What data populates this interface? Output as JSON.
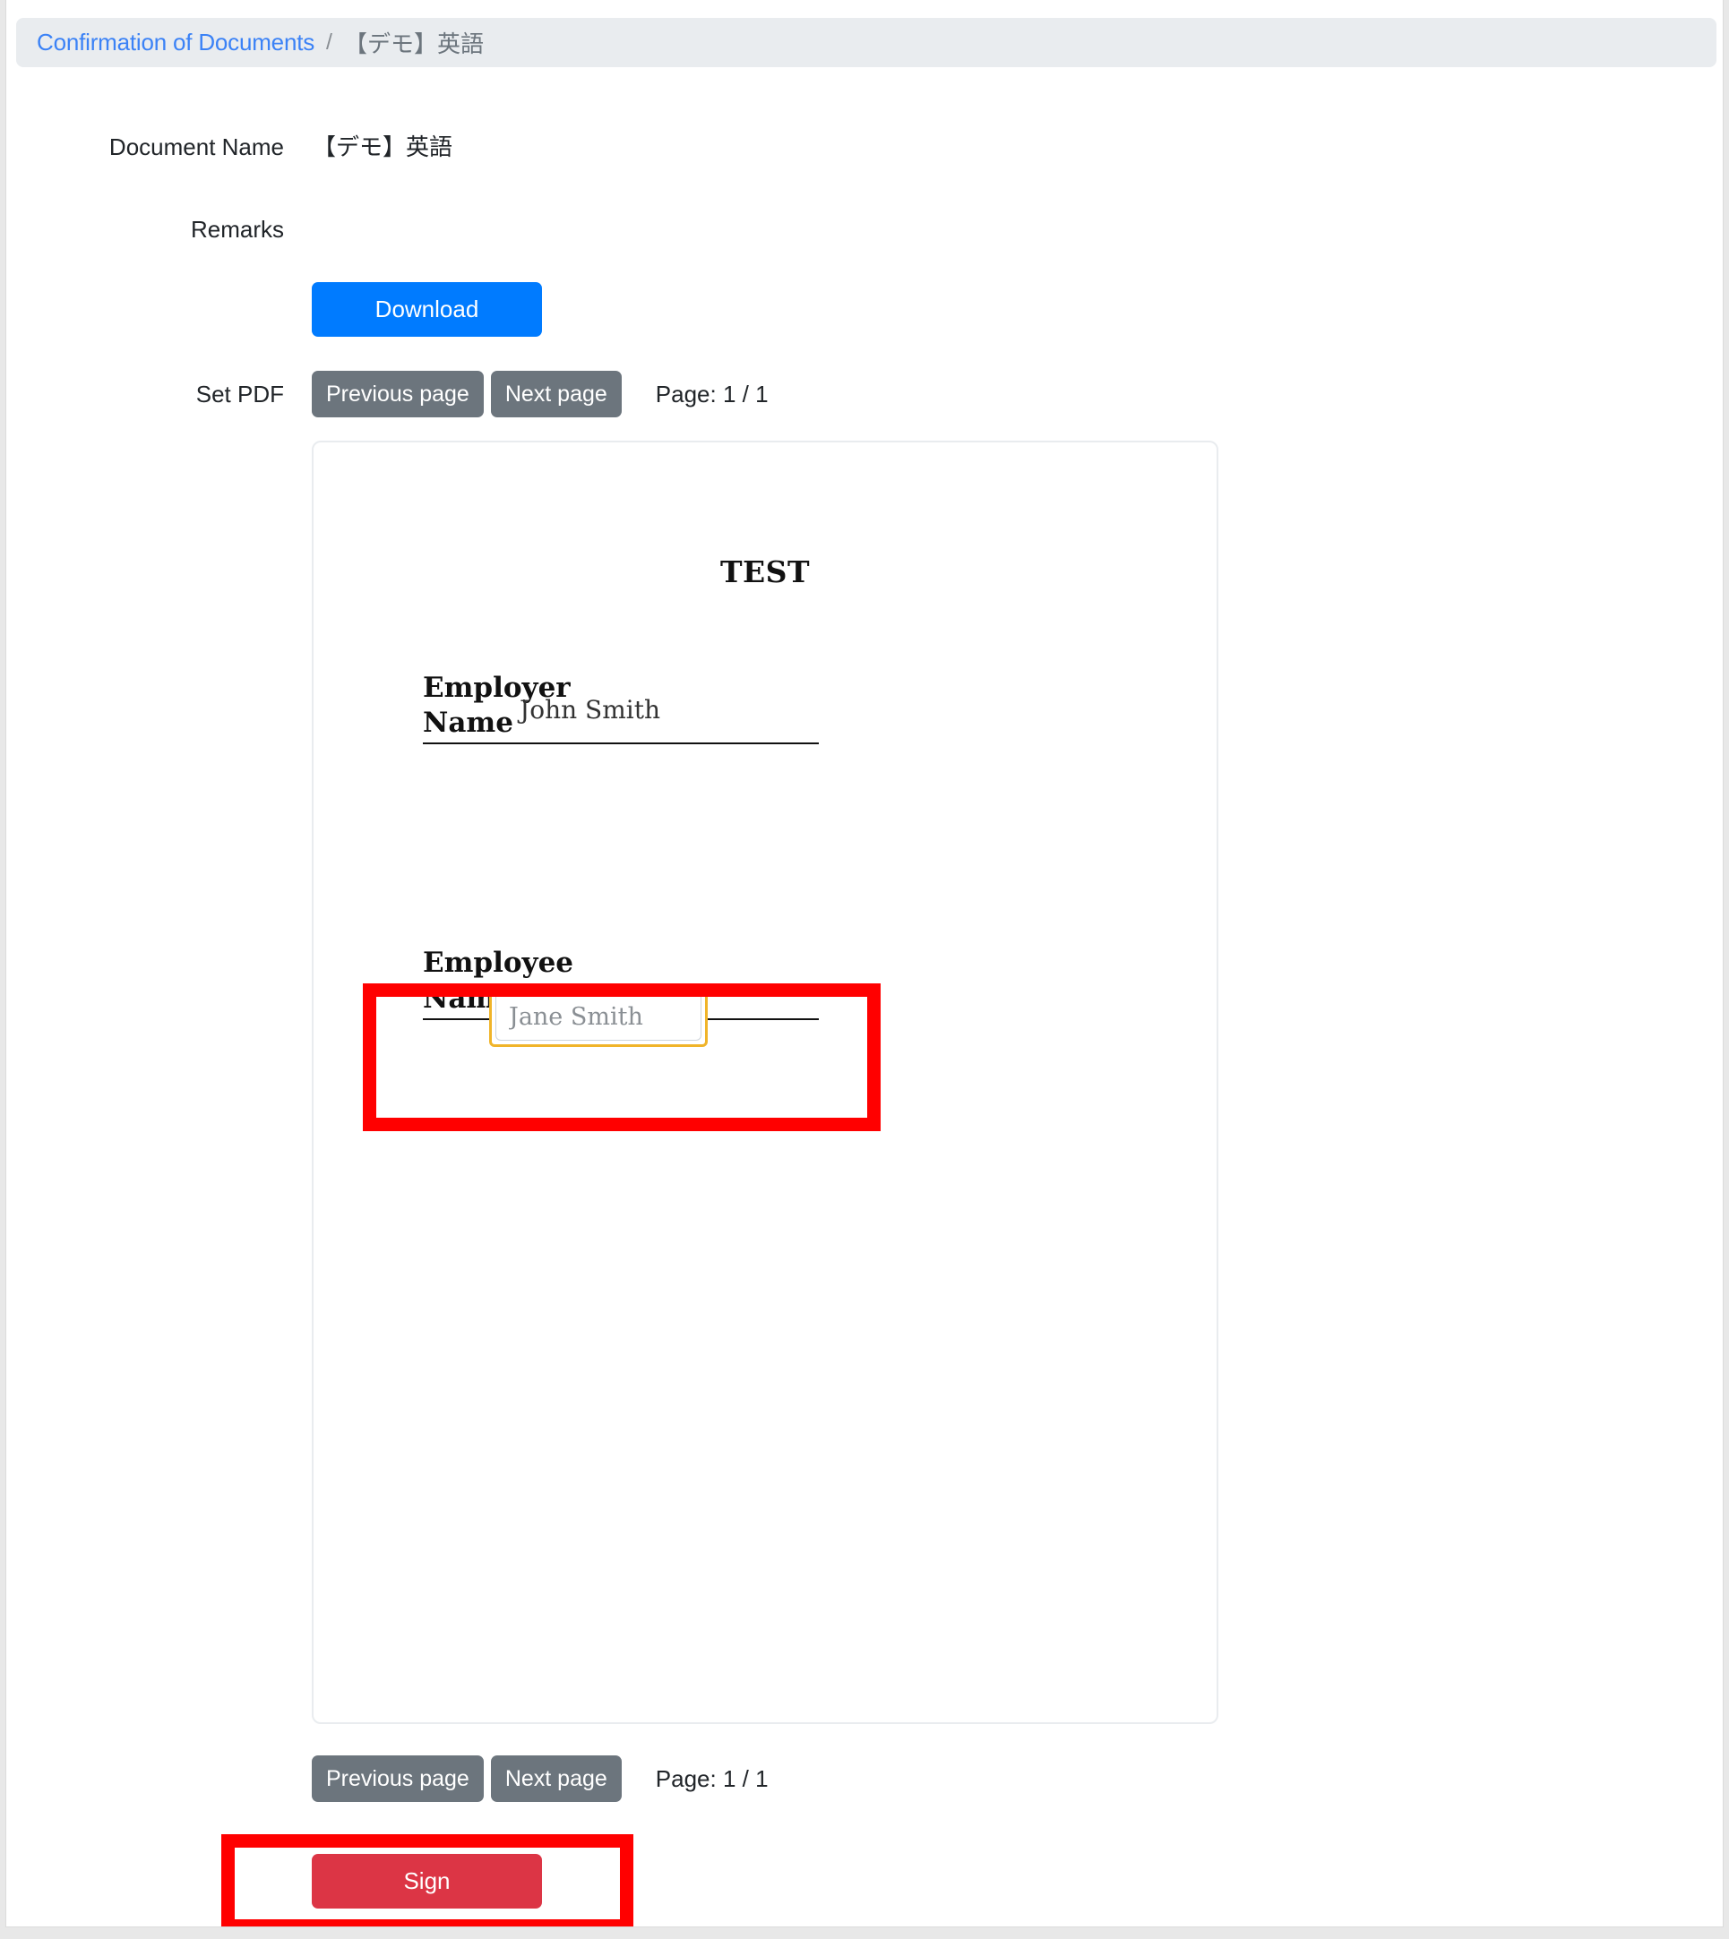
{
  "breadcrumb": {
    "link": "Confirmation of Documents",
    "separator": "/",
    "current": "【デモ】英語"
  },
  "form": {
    "document_name_label": "Document Name",
    "document_name_value": "【デモ】英語",
    "remarks_label": "Remarks",
    "remarks_value": "",
    "set_pdf_label": "Set PDF"
  },
  "buttons": {
    "download": "Download",
    "previous_page": "Previous page",
    "next_page": "Next page",
    "sign": "Sign"
  },
  "pager": {
    "top_indicator": "Page: 1 / 1",
    "bottom_indicator": "Page: 1 / 1"
  },
  "pdf": {
    "title": "TEST",
    "employer_heading": "Employer",
    "employer_name_label": "Name",
    "employer_name_value": "John Smith",
    "employee_heading": "Employee",
    "employee_name_label": "Name",
    "employee_name_placeholder": "Jane Smith",
    "employee_name_value": ""
  },
  "colors": {
    "breadcrumb_link": "#3b82f6",
    "breadcrumb_bg": "#e9ecef",
    "download_button": "#007bff",
    "page_button": "#6c757d",
    "sign_button": "#dc3545",
    "annotation_highlight": "#ff0000",
    "input_focus_ring": "#f0b429"
  }
}
